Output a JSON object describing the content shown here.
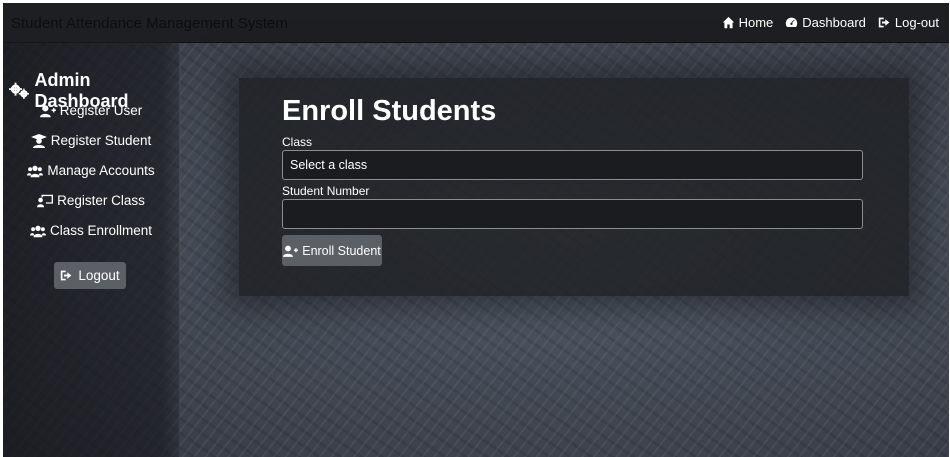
{
  "navbar": {
    "brand": "Student Attendance Management System",
    "links": [
      {
        "label": "Home",
        "icon": "home-icon"
      },
      {
        "label": "Dashboard",
        "icon": "dashboard-gauge-icon"
      },
      {
        "label": "Log-out",
        "icon": "logout-icon"
      }
    ]
  },
  "sidebar": {
    "title": "Admin Dashboard",
    "title_icon": "gears-icon",
    "items": [
      {
        "label": "Register User",
        "icon": "user-plus-icon"
      },
      {
        "label": "Register Student",
        "icon": "graduate-icon"
      },
      {
        "label": "Manage Accounts",
        "icon": "users-icon"
      },
      {
        "label": "Register Class",
        "icon": "chalkboard-teacher-icon"
      },
      {
        "label": "Class Enrollment",
        "icon": "users-icon"
      }
    ],
    "logout_label": "Logout"
  },
  "form": {
    "title": "Enroll Students",
    "class_label": "Class",
    "class_value": "Select a class",
    "student_number_label": "Student Number",
    "student_number_value": "",
    "submit_label": "Enroll Student"
  },
  "colors": {
    "navbar_bg": "#1e1f22",
    "card_bg": "#202226",
    "button_bg": "#5b5f66"
  }
}
